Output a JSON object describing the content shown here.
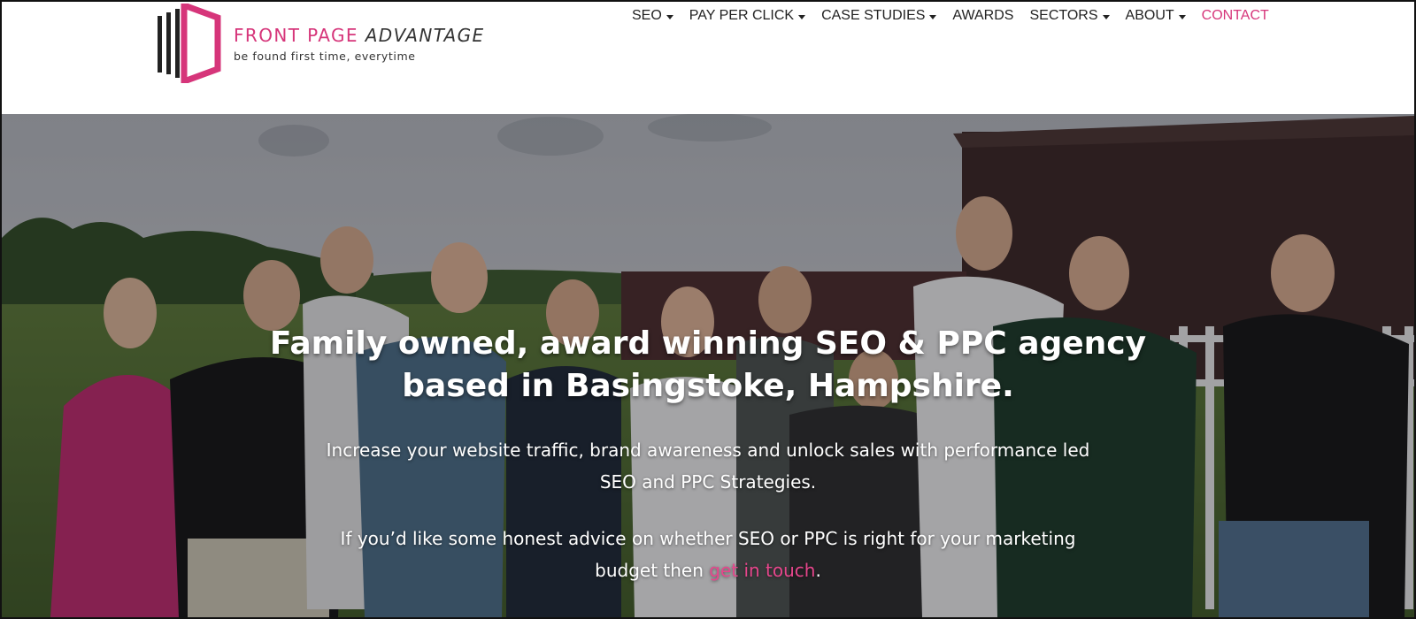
{
  "logo": {
    "title_main": "FRONT PAGE",
    "title_accent": "ADVANTAGE",
    "tagline": "be found first time, everytime"
  },
  "nav": {
    "items": [
      {
        "label": "SEO",
        "dropdown": true
      },
      {
        "label": "PAY PER CLICK",
        "dropdown": true
      },
      {
        "label": "CASE STUDIES",
        "dropdown": true
      },
      {
        "label": "AWARDS",
        "dropdown": false
      },
      {
        "label": "SECTORS",
        "dropdown": true
      },
      {
        "label": "ABOUT",
        "dropdown": true
      },
      {
        "label": "CONTACT",
        "dropdown": false
      }
    ]
  },
  "hero": {
    "title": "Family owned, award winning SEO & PPC agency based in Basingstoke, Hampshire.",
    "subtitle": "Increase your website traffic, brand awareness and unlock sales with performance led SEO and PPC Strategies.",
    "advice_prefix": "If you’d like some honest advice on whether SEO or PPC is right for your marketing budget then ",
    "advice_link": "get in touch",
    "advice_suffix": "."
  },
  "colors": {
    "brand_pink": "#d6357a",
    "link_pink": "#e6468c",
    "text_dark": "#222222"
  }
}
